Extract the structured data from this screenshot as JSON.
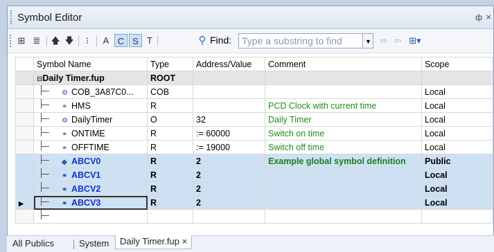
{
  "window": {
    "title": "Symbol Editor",
    "pin_glyph": "ф",
    "close_glyph": "×"
  },
  "toolbar": {
    "buttons": [
      "A",
      "C",
      "S",
      "T"
    ],
    "find_label": "Find:",
    "find_placeholder": "Type a substring to find"
  },
  "columns": [
    "Symbol Name",
    "Type",
    "Address/Value",
    "Comment",
    "Scope"
  ],
  "rows": [
    {
      "name": "Daily Timer.fup",
      "type": "ROOT",
      "address": "",
      "comment": "",
      "scope": ""
    },
    {
      "name": "COB_3A87C0...",
      "type": "COB",
      "address": "",
      "comment": "",
      "scope": "Local"
    },
    {
      "name": "HMS",
      "type": "R",
      "address": "",
      "comment": "PCD Clock with current time",
      "scope": "Local"
    },
    {
      "name": "DailyTimer",
      "type": "O",
      "address": "32",
      "comment": "Daily Timer",
      "scope": "Local"
    },
    {
      "name": "ONTIME",
      "type": "R",
      "address": ":= 60000",
      "comment": "Switch on time",
      "scope": "Local"
    },
    {
      "name": "OFFTIME",
      "type": "R",
      "address": ":= 19000",
      "comment": "Switch off time",
      "scope": "Local"
    },
    {
      "name": "ABCV0",
      "type": "R",
      "address": "2",
      "comment": "Example global symbol definition",
      "scope": "Public"
    },
    {
      "name": "ABCV1",
      "type": "R",
      "address": "2",
      "comment": "",
      "scope": "Local"
    },
    {
      "name": "ABCV2",
      "type": "R",
      "address": "2",
      "comment": "",
      "scope": "Local"
    },
    {
      "name": "ABCV3",
      "type": "R",
      "address": "2",
      "comment": "",
      "scope": "Local"
    }
  ],
  "tabs": [
    "All Publics",
    "System",
    "Daily Timer.fup ×"
  ]
}
